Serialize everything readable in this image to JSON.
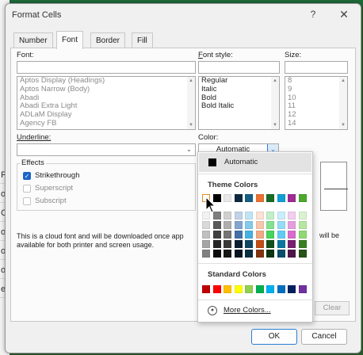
{
  "excel_bg": {
    "cells": [
      "F",
      "o",
      "C",
      "o",
      "o",
      "o",
      "e"
    ]
  },
  "dialog": {
    "title": "Format Cells",
    "help": "?",
    "close": "✕"
  },
  "tabs": [
    "Number",
    "Font",
    "Border",
    "Fill"
  ],
  "font": {
    "label": "Font:",
    "value": "",
    "list": [
      "Aptos Display (Headings)",
      "Aptos Narrow (Body)",
      "Abadi",
      "Abadi Extra Light",
      "ADLaM Display",
      "Agency FB"
    ]
  },
  "font_style": {
    "label": "Font style:",
    "value": "",
    "list": [
      "Regular",
      "Italic",
      "Bold",
      "Bold Italic"
    ]
  },
  "size": {
    "label": "Size:",
    "value": "",
    "list": [
      "8",
      "9",
      "10",
      "11",
      "12",
      "14"
    ]
  },
  "underline": {
    "label": "Underline:",
    "value": ""
  },
  "color": {
    "label": "Color:",
    "value": "Automatic"
  },
  "effects": {
    "title": "Effects",
    "strikethrough": {
      "label": "Strikethrough",
      "checked": true
    },
    "superscript": {
      "label": "Superscript",
      "checked": false
    },
    "subscript": {
      "label": "Subscript",
      "checked": false
    }
  },
  "info_text": {
    "line1": "This is a cloud font and will be downloaded once app",
    "line1_tail": "will be",
    "line2": "available for both printer and screen usage."
  },
  "buttons": {
    "clear": "Clear",
    "ok": "OK",
    "cancel": "Cancel"
  },
  "color_menu": {
    "automatic": "Automatic",
    "theme_heading": "Theme Colors",
    "theme_top": [
      "#ffffff",
      "#000000",
      "#e8e8e8",
      "#0e2841",
      "#156082",
      "#e97132",
      "#196b24",
      "#0f9ed5",
      "#a02b93",
      "#4ea72e"
    ],
    "theme_tints": [
      [
        "#f2f2f2",
        "#7f7f7f",
        "#d0d0d0",
        "#c0d2e6",
        "#c0e4f5",
        "#fbe2d5",
        "#c1f0c8",
        "#caeefb",
        "#f2ceef",
        "#daf2d0"
      ],
      [
        "#d9d9d9",
        "#595959",
        "#aeaeae",
        "#83a5cf",
        "#83caeb",
        "#f7c7ac",
        "#83e28e",
        "#95dcf7",
        "#e59edd",
        "#b5e6a2"
      ],
      [
        "#bfbfbf",
        "#404040",
        "#757575",
        "#4470a8",
        "#46b1e1",
        "#f1a983",
        "#47d45a",
        "#61cbf3",
        "#d86dcd",
        "#8ed973"
      ],
      [
        "#a6a6a6",
        "#262626",
        "#3a3a3a",
        "#0a1e31",
        "#0f4761",
        "#c04f15",
        "#124f1a",
        "#0b76a0",
        "#78206e",
        "#3a7d22"
      ],
      [
        "#808080",
        "#0d0d0d",
        "#171717",
        "#051421",
        "#0a2f40",
        "#80350e",
        "#0c3511",
        "#074f6a",
        "#4f1548",
        "#275317"
      ]
    ],
    "standard_heading": "Standard Colors",
    "standard": [
      "#c00000",
      "#ff0000",
      "#ffc000",
      "#ffff00",
      "#92d050",
      "#00b050",
      "#00b0f0",
      "#0070c0",
      "#002060",
      "#7030a0"
    ],
    "more_colors": "More Colors...",
    "selected_index": 0
  }
}
